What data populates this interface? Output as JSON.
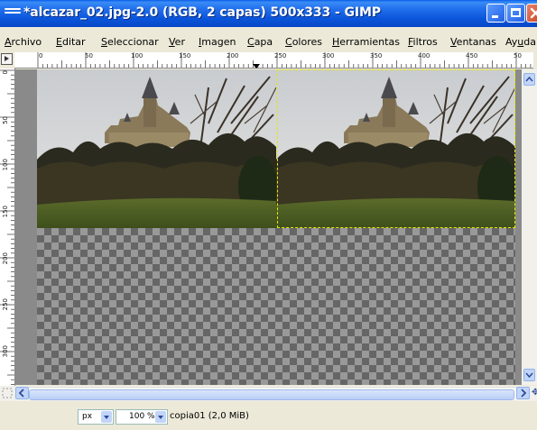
{
  "window": {
    "title": "*alcazar_02.jpg-2.0 (RGB, 2 capas) 500x333 - GIMP"
  },
  "menu": [
    {
      "label": "Archivo",
      "accel": "A",
      "rest": "rchivo"
    },
    {
      "label": "Editar",
      "accel": "E",
      "rest": "ditar"
    },
    {
      "label": "Seleccionar",
      "accel": "S",
      "rest": "eleccionar"
    },
    {
      "label": "Ver",
      "accel": "V",
      "rest": "er"
    },
    {
      "label": "Imagen",
      "accel": "I",
      "rest": "magen"
    },
    {
      "label": "Capa",
      "accel": "C",
      "rest": "apa"
    },
    {
      "label": "Colores",
      "accel": "C",
      "rest": "olores"
    },
    {
      "label": "Herramientas",
      "accel": "H",
      "rest": "erramientas"
    },
    {
      "label": "Filtros",
      "accel": "F",
      "rest": "iltros"
    },
    {
      "label": "Ventanas",
      "accel": "V",
      "rest": "entanas"
    },
    {
      "label": "Ayuda",
      "rest_pre": "Ay",
      "accel": "u",
      "rest": "da"
    }
  ],
  "ruler": {
    "h_labels": [
      "0",
      "50",
      "100",
      "150",
      "200",
      "250",
      "300",
      "350",
      "400",
      "450",
      "50"
    ],
    "v_labels": [
      "0",
      "50",
      "100",
      "150",
      "200",
      "250",
      "300",
      "350"
    ]
  },
  "statusbar": {
    "unit": "px",
    "zoom": "100 %",
    "layer_info": "copia01 (2,0 MiB)"
  },
  "icons": {
    "window_menu": "window-menu-icon",
    "navigate": "navigate-icon",
    "quick_mask": "quick-mask-icon"
  }
}
